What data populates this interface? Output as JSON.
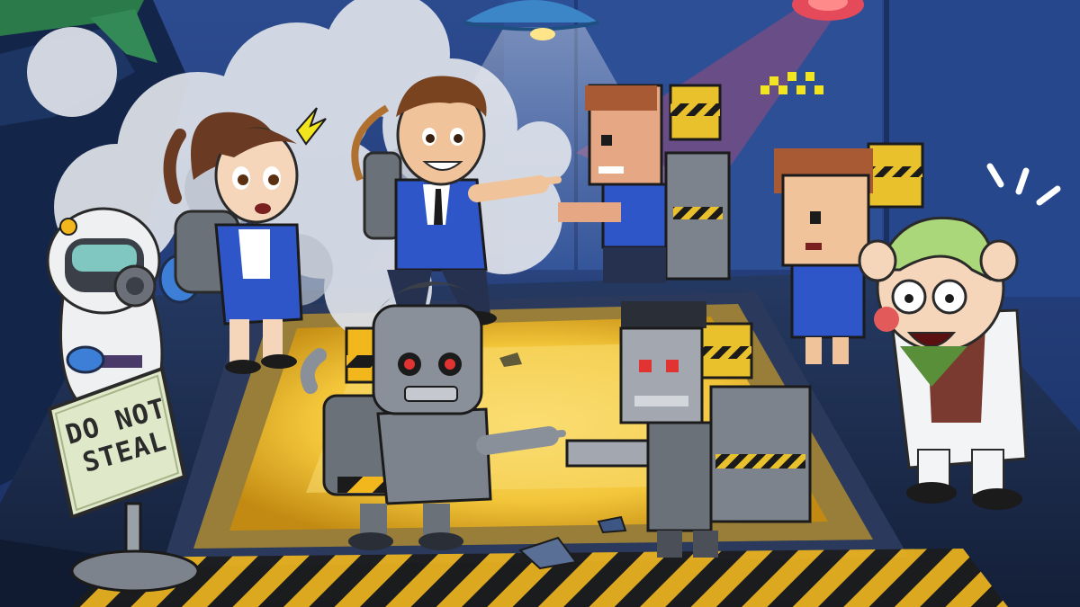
{
  "scene": {
    "sign": {
      "line1": "DO NOT",
      "line2": "STEAL"
    },
    "colors": {
      "wall": "#23407e",
      "wall_dark": "#162a58",
      "floor": "#1e2d4d",
      "pit_glow": "#f3c63a",
      "hazard_yellow": "#f2b71d",
      "smoke": "#dfe3ea"
    },
    "characters": [
      {
        "name": "hazmat-scientist",
        "style": "cartoon"
      },
      {
        "name": "female-scientist",
        "style": "cartoon"
      },
      {
        "name": "barry-steakfries",
        "style": "cartoon"
      },
      {
        "name": "robot-barry",
        "style": "cartoon"
      },
      {
        "name": "pixel-barry",
        "style": "pixel"
      },
      {
        "name": "pixel-female-scientist",
        "style": "pixel"
      },
      {
        "name": "pixel-robot-barry",
        "style": "pixel"
      },
      {
        "name": "panicked-professor",
        "style": "cartoon"
      }
    ]
  }
}
